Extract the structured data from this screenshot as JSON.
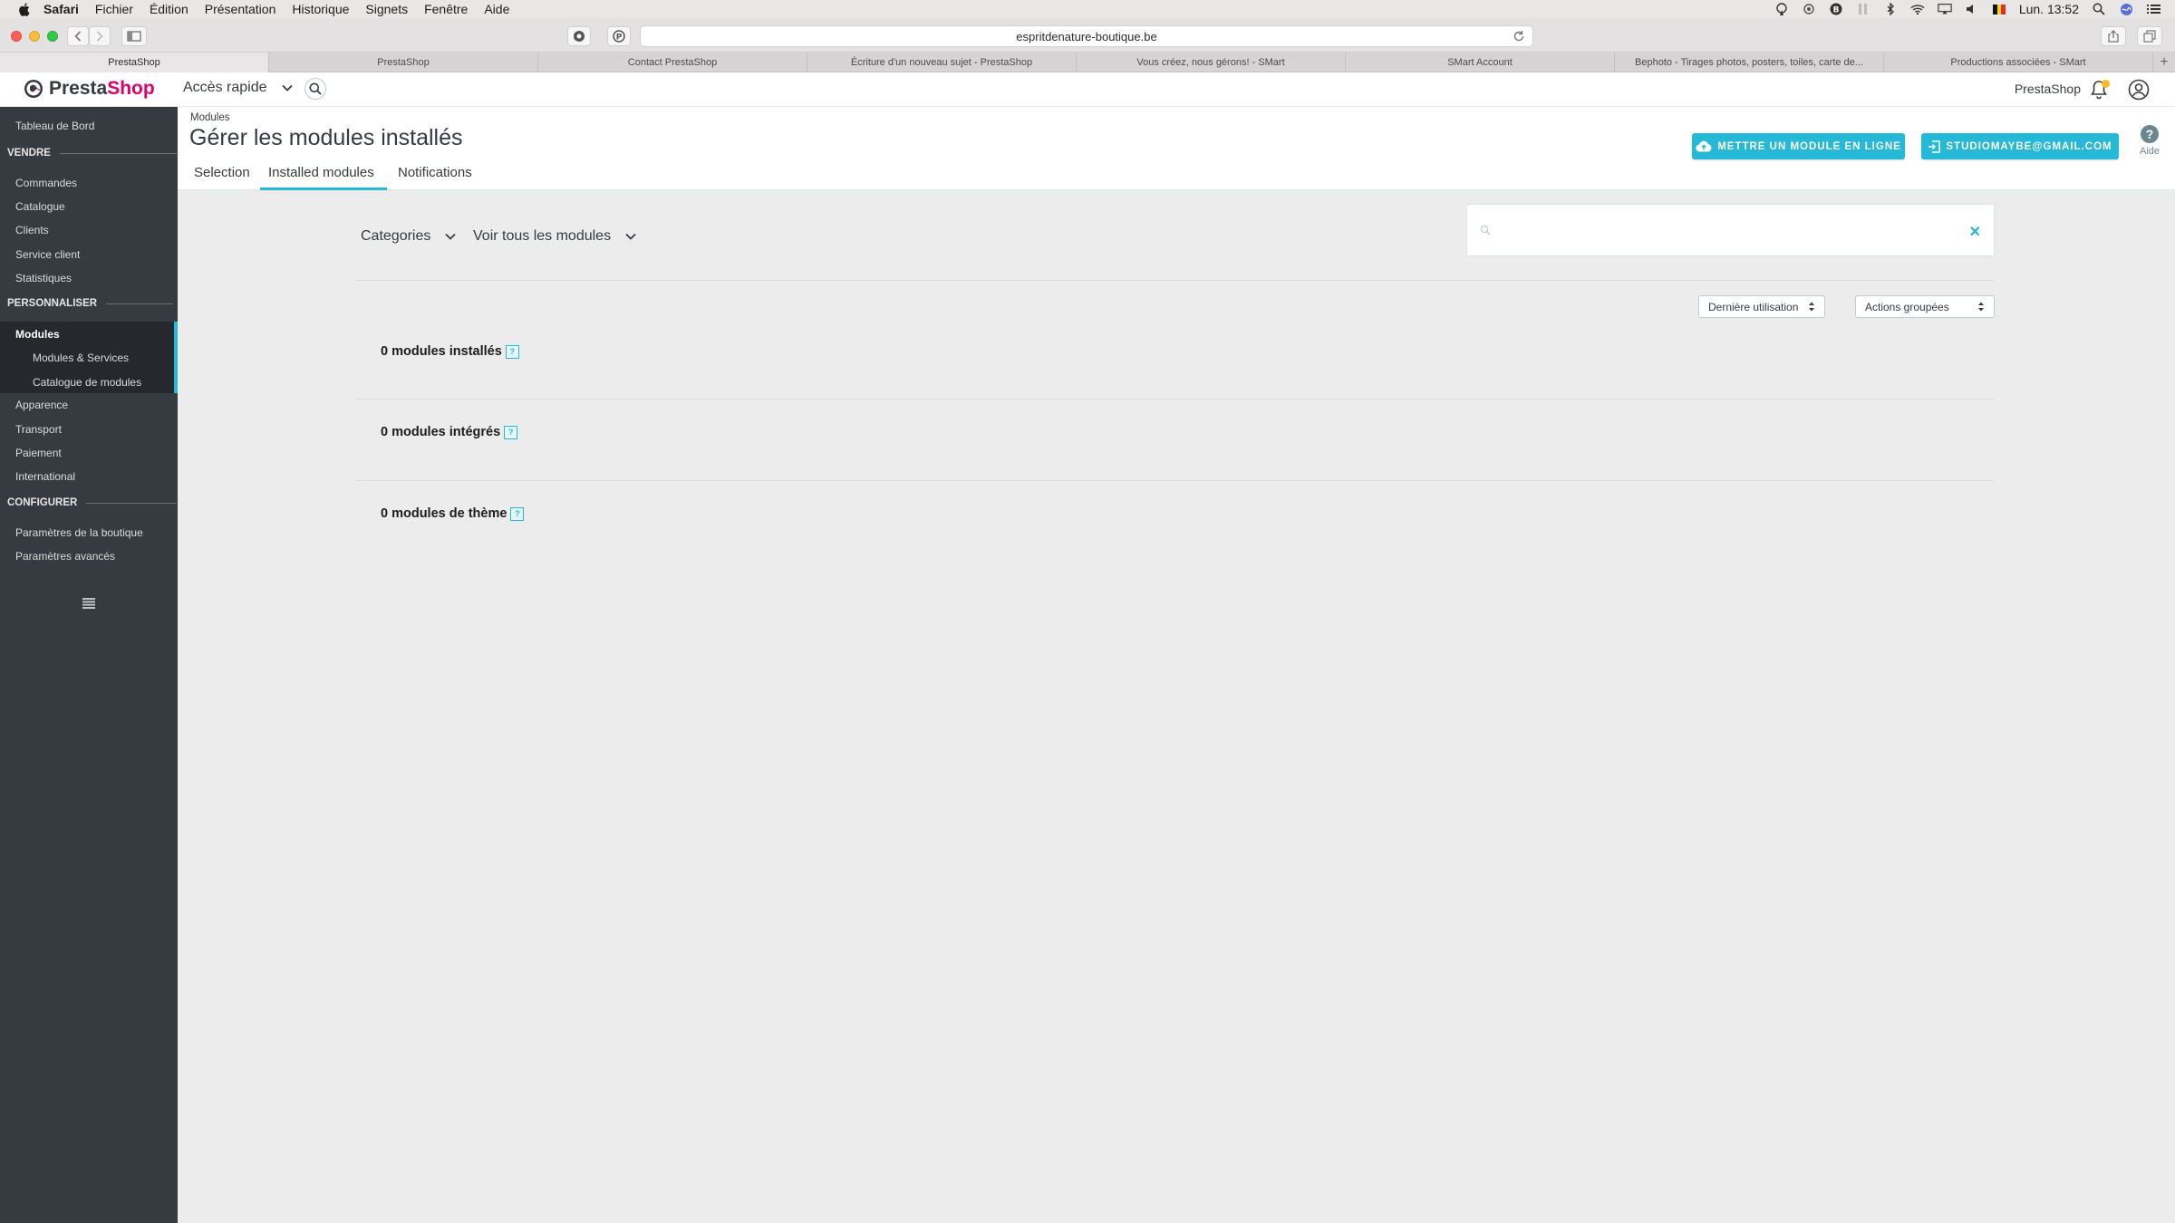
{
  "menubar": {
    "items": [
      "Safari",
      "Fichier",
      "Édition",
      "Présentation",
      "Historique",
      "Signets",
      "Fenêtre",
      "Aide"
    ],
    "clock": "Lun. 13:52"
  },
  "browser": {
    "url": "espritdenature-boutique.be",
    "tabs": [
      "PrestaShop",
      "PrestaShop",
      "Contact PrestaShop",
      "Écriture d'un nouveau sujet - PrestaShop",
      "Vous créez, nous gérons! - SMart",
      "SMart Account",
      "Bephoto - Tirages photos, posters, toiles, carte de...",
      "Productions associées - SMart"
    ]
  },
  "header": {
    "logo_presta": "Presta",
    "logo_shop": "Shop",
    "quick_access": "Accès rapide",
    "shop_name": "PrestaShop"
  },
  "sidebar": {
    "dashboard": "Tableau de Bord",
    "sections": [
      {
        "title": "VENDRE",
        "items": [
          "Commandes",
          "Catalogue",
          "Clients",
          "Service client",
          "Statistiques"
        ]
      },
      {
        "title": "PERSONNALISER",
        "items": [
          "Modules",
          "Apparence",
          "Transport",
          "Paiement",
          "International"
        ]
      },
      {
        "title": "CONFIGURER",
        "items": [
          "Paramètres de la boutique",
          "Paramètres avancés"
        ]
      }
    ],
    "modules_sub": [
      "Modules & Services",
      "Catalogue de modules"
    ]
  },
  "page": {
    "breadcrumb": "Modules",
    "title": "Gérer les modules installés",
    "tabs": [
      "Selection",
      "Installed modules",
      "Notifications"
    ],
    "upload_button": "METTRE UN MODULE EN LIGNE",
    "account_button": "STUDIOMAYBE@GMAIL.COM",
    "help_label": "Aide"
  },
  "filters": {
    "categories": "Categories",
    "view_all": "Voir tous les modules",
    "sort_select": "Dernière utilisation",
    "bulk_select": "Actions groupées",
    "search_value": ""
  },
  "sections": [
    {
      "label": "0 modules installés"
    },
    {
      "label": "0 modules intégrés"
    },
    {
      "label": "0 modules de thème"
    }
  ],
  "colors": {
    "accent": "#25b9d7",
    "sidebar": "#363a41",
    "brand_pink": "#df0067"
  }
}
